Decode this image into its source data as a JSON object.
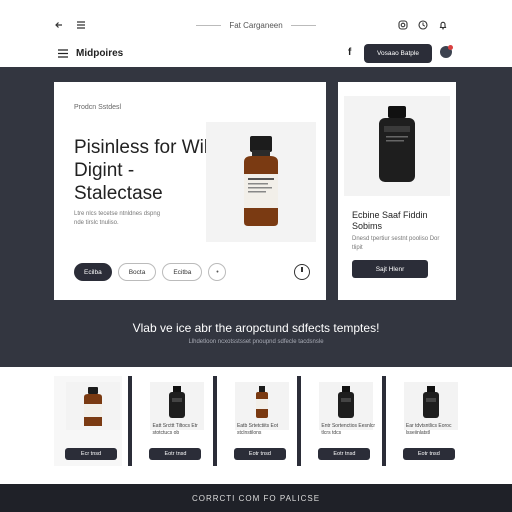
{
  "topbar": {
    "back_icon": "arrow-left-icon",
    "menu_icon": "list-icon",
    "center_label": "Fat Carganeen",
    "right_icons": [
      "instagram-icon",
      "clock-icon",
      "bell-icon"
    ]
  },
  "nav": {
    "title": "Midpoires",
    "social": "f",
    "cta": "Vosaao Batple"
  },
  "hero": {
    "eyebrow": "Prodcn Sstdesl",
    "title": "Pisinless for Will Digint - Stalectase",
    "description": "Ltre nlcs tecetse ntnldnes dspng nde tirslc tnuliso.",
    "button_primary": "Ecilba",
    "button_secondary_1": "Bocta",
    "button_secondary_2": "Ecitba",
    "circle_symbol": "•"
  },
  "side_card": {
    "title": "Ecbine Saaf Fiddin Sobims",
    "description": "Dnesd tpertiur sestnt pooliso Dor tlipit",
    "button": "Sajt Hlenr"
  },
  "band": {
    "heading": "Vlab ve ice abr the aropctund sdfects temptes!",
    "subheading": "Llhdetloon ncxotsstsset pnoupnd sdfecle tacdsnsle"
  },
  "products": [
    {
      "name": "",
      "button": "Ecr tnsd"
    },
    {
      "name": "Eatt Srcttt Tiltocs Etr stotctucs ob",
      "button": "Eotr tnsd"
    },
    {
      "name": "Eatb Srtetctiits Eot stclnstilons",
      "button": "Eotr tnsd"
    },
    {
      "name": "Entr Sortenctios Eesnlcr tlcrs tdcs",
      "button": "Eotr tnsd"
    },
    {
      "name": "Ear tdvtsntlics Eoroc lsseiinlatstl",
      "button": "Eotr tnsd"
    }
  ],
  "footer": {
    "text": "CORRCTI COM FO PALICSE"
  },
  "colors": {
    "dark": "#2b2d38",
    "band": "#333640",
    "footer": "#1f2128",
    "amber_bottle": "#7a3a12",
    "notification": "#d94040"
  }
}
